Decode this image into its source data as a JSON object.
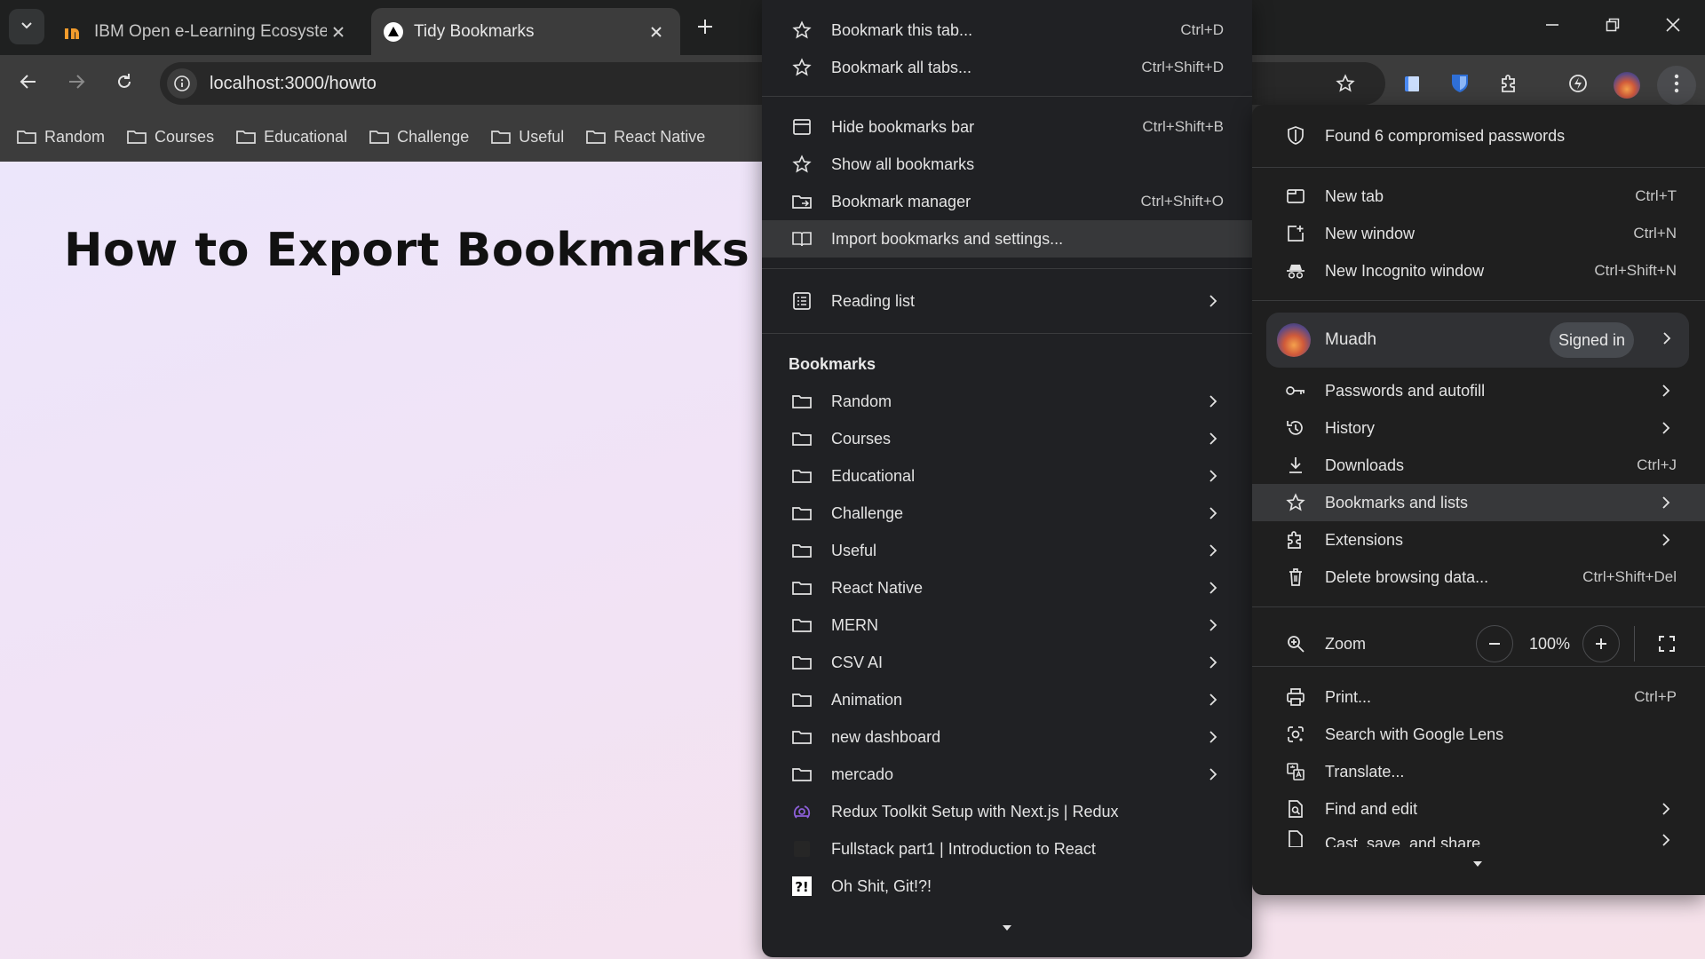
{
  "tabs": [
    {
      "title": "IBM Open e-Learning Ecosyster",
      "favicon": "ibm-in-icon"
    },
    {
      "title": "Tidy Bookmarks",
      "favicon": "triangle-logo-icon"
    }
  ],
  "address": {
    "url": "localhost:3000/howto"
  },
  "bookmarks_bar": [
    "Random",
    "Courses",
    "Educational",
    "Challenge",
    "Useful",
    "React Native"
  ],
  "page": {
    "heading": "How to Export Bookmarks"
  },
  "bookmarks_submenu": {
    "items_top": [
      {
        "label": "Bookmark this tab...",
        "shortcut": "Ctrl+D",
        "icon": "star-icon"
      },
      {
        "label": "Bookmark all tabs...",
        "shortcut": "Ctrl+Shift+D",
        "icon": "star-icon"
      }
    ],
    "items_mid": [
      {
        "label": "Hide bookmarks bar",
        "shortcut": "Ctrl+Shift+B",
        "icon": "window-icon"
      },
      {
        "label": "Show all bookmarks",
        "shortcut": "",
        "icon": "star-icon"
      },
      {
        "label": "Bookmark manager",
        "shortcut": "Ctrl+Shift+O",
        "icon": "folder-arrow-icon"
      },
      {
        "label": "Import bookmarks and settings...",
        "shortcut": "",
        "icon": "book-icon"
      }
    ],
    "reading_list": "Reading list",
    "section_title": "Bookmarks",
    "folders": [
      "Random",
      "Courses",
      "Educational",
      "Challenge",
      "Useful",
      "React Native",
      "MERN",
      "CSV AI",
      "Animation",
      "new dashboard",
      "mercado"
    ],
    "links": [
      {
        "label": "Redux Toolkit Setup with Next.js | Redux",
        "icon": "redux-icon"
      },
      {
        "label": "Fullstack part1 | Introduction to React",
        "icon": "blank-page-icon"
      },
      {
        "label": "Oh Shit, Git!?!",
        "icon": "ohshitgit-icon"
      }
    ]
  },
  "main_menu": {
    "alert": "Found 6 compromised passwords",
    "group1": [
      {
        "label": "New tab",
        "shortcut": "Ctrl+T"
      },
      {
        "label": "New window",
        "shortcut": "Ctrl+N"
      },
      {
        "label": "New Incognito window",
        "shortcut": "Ctrl+Shift+N"
      }
    ],
    "profile": {
      "name": "Muadh",
      "status": "Signed in"
    },
    "group2": [
      {
        "label": "Passwords and autofill",
        "shortcut": "",
        "arrow": true
      },
      {
        "label": "History",
        "shortcut": "",
        "arrow": true
      },
      {
        "label": "Downloads",
        "shortcut": "Ctrl+J",
        "arrow": false
      },
      {
        "label": "Bookmarks and lists",
        "shortcut": "",
        "arrow": true
      },
      {
        "label": "Extensions",
        "shortcut": "",
        "arrow": true
      },
      {
        "label": "Delete browsing data...",
        "shortcut": "Ctrl+Shift+Del",
        "arrow": false
      }
    ],
    "zoom": {
      "label": "Zoom",
      "value": "100%"
    },
    "group3": [
      {
        "label": "Print...",
        "shortcut": "Ctrl+P",
        "arrow": false
      },
      {
        "label": "Search with Google Lens",
        "shortcut": "",
        "arrow": false
      },
      {
        "label": "Translate...",
        "shortcut": "",
        "arrow": false
      },
      {
        "label": "Find and edit",
        "shortcut": "",
        "arrow": true
      },
      {
        "label": "Cast, save, and share",
        "shortcut": "",
        "arrow": true
      }
    ]
  },
  "colors": {
    "menu_bg": "#202124",
    "highlight": "#37383a",
    "chrome": "#3c3c3c",
    "accent_shield": "#2f6fd6"
  }
}
